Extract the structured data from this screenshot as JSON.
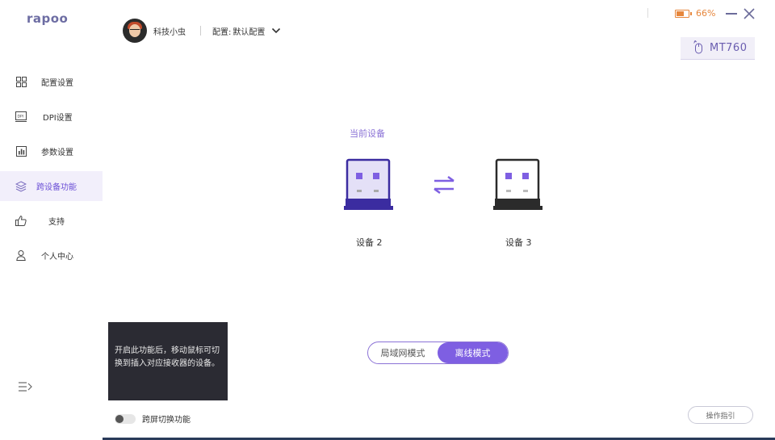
{
  "app": {
    "logo": "rapoo"
  },
  "sidebar": {
    "items": [
      {
        "label": "配置设置",
        "icon": "grid-icon",
        "active": false
      },
      {
        "label": "DPI设置",
        "icon": "dpi-icon",
        "active": false
      },
      {
        "label": "参数设置",
        "icon": "chart-icon",
        "active": false
      },
      {
        "label": "跨设备功能",
        "icon": "layers-icon",
        "active": true
      },
      {
        "label": "支持",
        "icon": "thumbs-up-icon",
        "active": false
      },
      {
        "label": "个人中心",
        "icon": "user-icon",
        "active": false
      }
    ]
  },
  "header": {
    "username": "科技小虫",
    "profile_label": "配置:",
    "profile_value": "默认配置"
  },
  "status": {
    "battery_percent": "66%",
    "battery_level": 0.66,
    "device_name": "MT760"
  },
  "main": {
    "section_title": "当前设备",
    "device_a": "设备 2",
    "device_b": "设备 3",
    "mode_lan": "局域网模式",
    "mode_offline": "离线模式",
    "selected_mode": "离线模式"
  },
  "tooltip": {
    "text": "开启此功能后，移动鼠标可切换到插入对应接收器的设备。"
  },
  "toggle": {
    "label": "跨屏切换功能",
    "enabled": false
  },
  "guide_button": "操作指引",
  "colors": {
    "accent": "#7e5fe2",
    "accent_text": "#8b72d6",
    "battery": "#e6863c",
    "receiver_active": "#3b2ca0",
    "receiver_inactive": "#2b2b2b"
  }
}
